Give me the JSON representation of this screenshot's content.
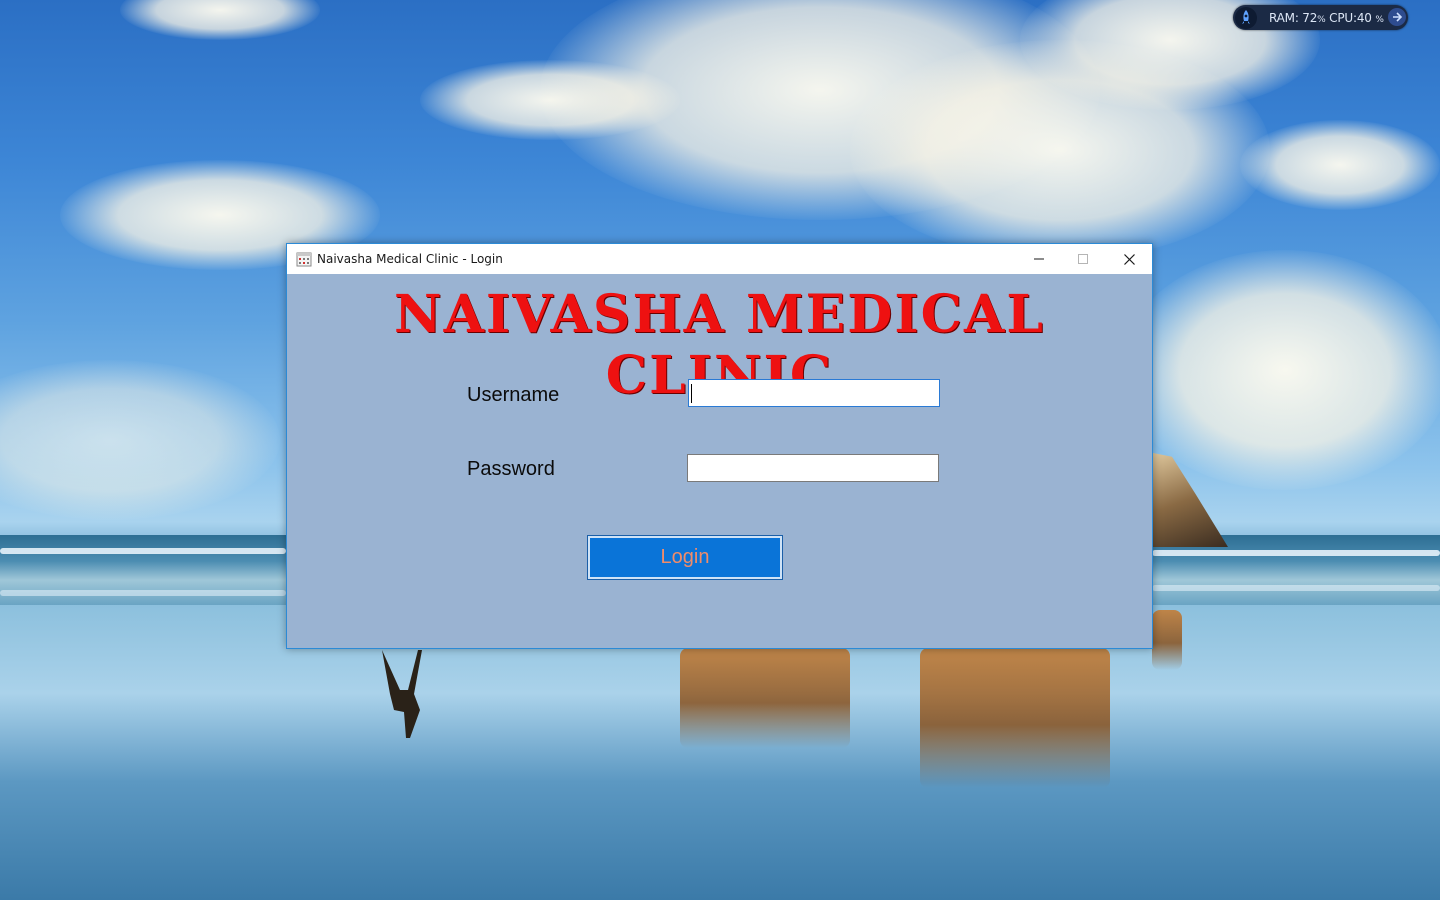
{
  "desktop": {
    "monitor": {
      "ram_label": "RAM:",
      "ram_value": "72",
      "cpu_label": "CPU:",
      "cpu_value": "40",
      "percent": "%",
      "rocket_icon": "rocket-icon",
      "arrow_icon": "arrow-right-icon"
    }
  },
  "window": {
    "title": "Naivasha Medical Clinic - Login",
    "app_icon": "clinic-app-icon",
    "controls": {
      "minimize_icon": "minimize-icon",
      "maximize_icon": "maximize-icon",
      "close_icon": "close-icon"
    }
  },
  "login_form": {
    "heading": "NAIVASHA MEDICAL CLINIC",
    "heading_color": "#ee1111",
    "username_label": "Username",
    "username_value": "",
    "password_label": "Password",
    "password_value": "",
    "login_button": "Login",
    "login_button_color": "#0a74d8",
    "panel_color": "#9ab3d2"
  }
}
